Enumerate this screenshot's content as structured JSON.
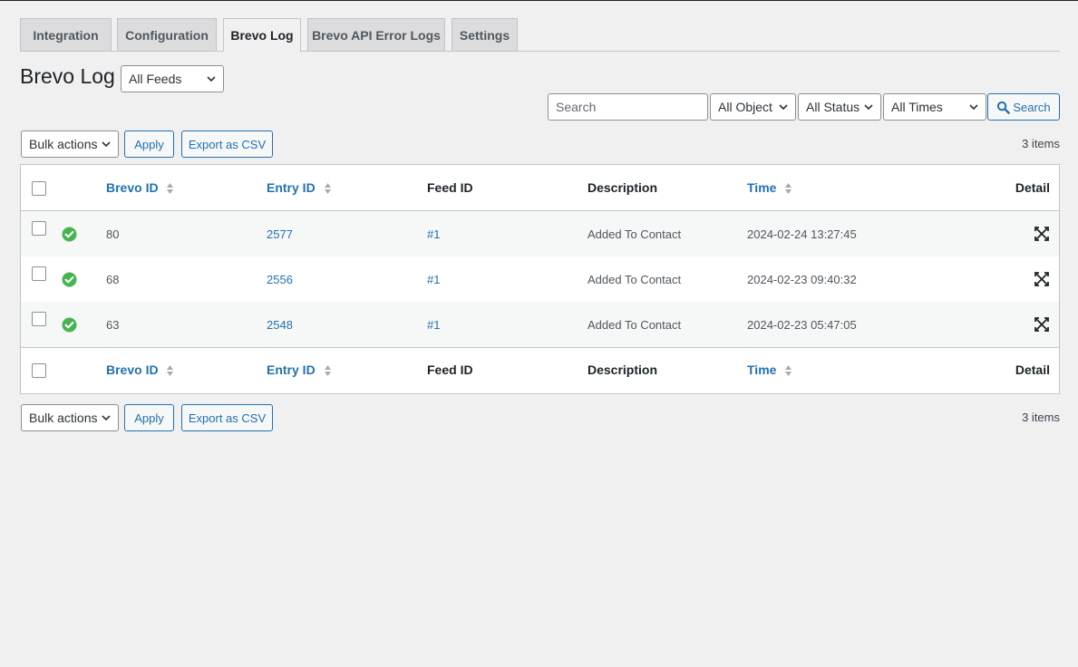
{
  "tabs": [
    {
      "label": "Integration"
    },
    {
      "label": "Configuration"
    },
    {
      "label": "Brevo Log"
    },
    {
      "label": "Brevo API Error Logs"
    },
    {
      "label": "Settings"
    }
  ],
  "page_title": "Brevo Log",
  "feed_filter": {
    "selected": "All Feeds"
  },
  "filters": {
    "search_placeholder": "Search",
    "object": "All Object",
    "status": "All Status",
    "times": "All Times",
    "search_button": "Search"
  },
  "top_actions": {
    "bulk": "Bulk actions",
    "apply": "Apply",
    "export": "Export as CSV",
    "count": "3 items"
  },
  "bottom_actions": {
    "bulk": "Bulk actions",
    "apply": "Apply",
    "export": "Export as CSV",
    "count": "3 items"
  },
  "table": {
    "columns": {
      "brevo_id": "Brevo ID",
      "entry_id": "Entry ID",
      "feed_id": "Feed ID",
      "description": "Description",
      "time": "Time",
      "detail": "Detail"
    },
    "rows": [
      {
        "brevo_id": "80",
        "entry_id": "2577",
        "feed_id": "#1",
        "description": "Added To Contact",
        "time": "2024-02-24 13:27:45"
      },
      {
        "brevo_id": "68",
        "entry_id": "2556",
        "feed_id": "#1",
        "description": "Added To Contact",
        "time": "2024-02-23 09:40:32"
      },
      {
        "brevo_id": "63",
        "entry_id": "2548",
        "feed_id": "#1",
        "description": "Added To Contact",
        "time": "2024-02-23 05:47:05"
      }
    ]
  },
  "colors": {
    "accent": "#2271b1",
    "success": "#46b450",
    "background": "#f0f0f1"
  },
  "icons": {
    "status": "check-circle-icon",
    "detail": "expand-icon",
    "sort": "sort-arrows-icon",
    "search": "search-icon",
    "chevron": "chevron-down-icon"
  }
}
